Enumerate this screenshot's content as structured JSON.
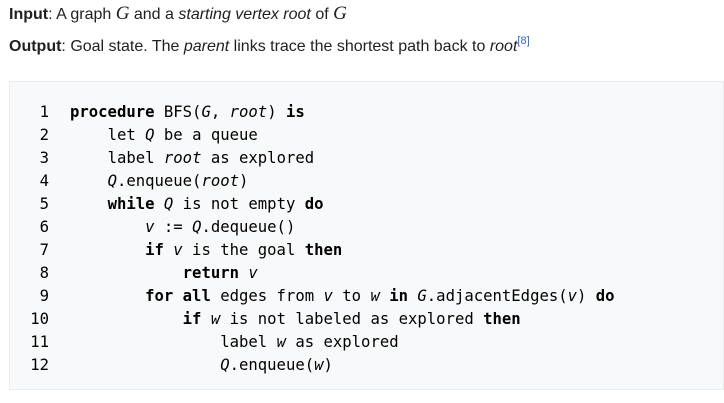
{
  "io": {
    "input_label": "Input",
    "input_text_a": ": A graph ",
    "input_G": "G",
    "input_text_b": " and a ",
    "input_text_c": "starting vertex root",
    "input_text_d": " of ",
    "input_G2": "G",
    "output_label": "Output",
    "output_text_a": ": Goal state. The ",
    "output_text_b": "parent",
    "output_text_c": " links trace the shortest path back to ",
    "output_text_d": "root",
    "output_ref": "[8]"
  },
  "code": {
    "line_numbers": [
      "1",
      "2",
      "3",
      "4",
      "5",
      "6",
      "7",
      "8",
      "9",
      "10",
      "11",
      "12"
    ],
    "l1": {
      "kw": "procedure",
      "a": " BFS(",
      "b": "G",
      "c": ", ",
      "d": "root",
      "e": ") ",
      "f": "is"
    },
    "l2": {
      "a": "let ",
      "b": "Q",
      "c": " be a queue"
    },
    "l3": {
      "a": "label ",
      "b": "root",
      "c": " as explored"
    },
    "l4": {
      "a": "Q",
      "b": ".enqueue(",
      "c": "root",
      "d": ")"
    },
    "l5": {
      "kw": "while",
      "a": " ",
      "b": "Q",
      "c": " is not empty ",
      "d": "do"
    },
    "l6": {
      "a": "v",
      "b": " := ",
      "c": "Q",
      "d": ".dequeue()"
    },
    "l7": {
      "kw": "if",
      "a": " ",
      "b": "v",
      "c": " is the goal ",
      "d": "then"
    },
    "l8": {
      "kw": "return",
      "a": " ",
      "b": "v"
    },
    "l9": {
      "kw": "for all",
      "a": " edges from ",
      "b": "v",
      "c": " to ",
      "d": "w",
      "e": " ",
      "f": "in",
      "g": " ",
      "h": "G",
      "i": ".adjacentEdges(",
      "j": "v",
      "k": ") ",
      "l": "do"
    },
    "l10": {
      "kw": "if",
      "a": " ",
      "b": "w",
      "c": " is not labeled as explored ",
      "d": "then"
    },
    "l11": {
      "a": "label ",
      "b": "w",
      "c": " as explored"
    },
    "l12": {
      "a": "Q",
      "b": ".enqueue(",
      "c": "w",
      "d": ")"
    }
  }
}
